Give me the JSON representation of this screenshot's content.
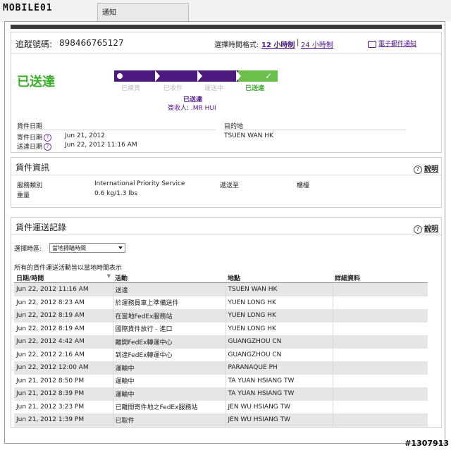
{
  "browser": {
    "logo_text": "MOBILE01",
    "tab_label": "通知"
  },
  "tracking": {
    "number_label": "追蹤號碼:",
    "number": "898466765127",
    "time_format_label": "選擇時間格式:",
    "format_12": "12 小時制",
    "format_sep": "|",
    "format_24": "24 小時制",
    "email_label": "電子郵件通知",
    "status": "已送達",
    "stages": [
      "已揀貨",
      "已收件",
      "運送中",
      "已送達"
    ],
    "progress_fraction": 1.0,
    "status_small": "已送達",
    "signed_by": "簽收人: .MR HUI",
    "shipment_dates_label": "貨件日期",
    "ship_date_label": "寄件日期",
    "ship_date": "Jun 21, 2012",
    "delivery_date_label": "送達日期",
    "delivery_date": "Jun 22, 2012 11:16 AM",
    "destination_label": "目的地",
    "destination": "TSUEN WAN HK",
    "help_glyph": "?"
  },
  "shipment": {
    "title": "貨件資訊",
    "help_label": "說明",
    "service_label": "服務類別",
    "service": "International Priority Service",
    "delivered_to_label": "遞送至",
    "delivered_to": "櫃檯",
    "weight_label": "重量",
    "weight": "0.6 kg/1.3 lbs"
  },
  "history": {
    "title": "貨件運送記錄",
    "help_label": "說明",
    "timezone_label": "選擇時區:",
    "timezone_value": "當地掃瞄時間",
    "note": "所有的貨件運送活動皆以當地時間表示",
    "columns": [
      "日期/時間",
      "活動",
      "地點",
      "詳細資料"
    ],
    "rows": [
      {
        "datetime": "Jun 22, 2012 11:16 AM",
        "activity": "送達",
        "location": "TSUEN WAN HK",
        "details": ""
      },
      {
        "datetime": "Jun 22, 2012 8:23 AM",
        "activity": "於運務員車上準備送件",
        "location": "YUEN LONG HK",
        "details": ""
      },
      {
        "datetime": "Jun 22, 2012 8:19 AM",
        "activity": "在當地FedEx服務站",
        "location": "YUEN LONG HK",
        "details": ""
      },
      {
        "datetime": "Jun 22, 2012 8:19 AM",
        "activity": "國際貨件放行 - 進口",
        "location": "YUEN LONG HK",
        "details": ""
      },
      {
        "datetime": "Jun 22, 2012 4:42 AM",
        "activity": "離開FedEx轉運中心",
        "location": "GUANGZHOU CN",
        "details": ""
      },
      {
        "datetime": "Jun 22, 2012 2:16 AM",
        "activity": "到達FedEx轉運中心",
        "location": "GUANGZHOU CN",
        "details": ""
      },
      {
        "datetime": "Jun 22, 2012 12:00 AM",
        "activity": "運輸中",
        "location": "PARANAQUE PH",
        "details": ""
      },
      {
        "datetime": "Jun 21, 2012 8:50 PM",
        "activity": "運輸中",
        "location": "TA YUAN HSIANG TW",
        "details": ""
      },
      {
        "datetime": "Jun 21, 2012 8:39 PM",
        "activity": "運輸中",
        "location": "TA YUAN HSIANG TW",
        "details": ""
      },
      {
        "datetime": "Jun 21, 2012 3:23 PM",
        "activity": "已離開寄件地之FedEx服務站",
        "location": "JEN WU HSIANG TW",
        "details": ""
      },
      {
        "datetime": "Jun 21, 2012 1:39 PM",
        "activity": "已取件",
        "location": "JEN WU HSIANG TW",
        "details": ""
      }
    ]
  },
  "watermark": "#1307913",
  "colors": {
    "delivered_green": "#3dae2b",
    "fedex_purple": "#4d1a7f",
    "link_purple": "#4d148c"
  }
}
